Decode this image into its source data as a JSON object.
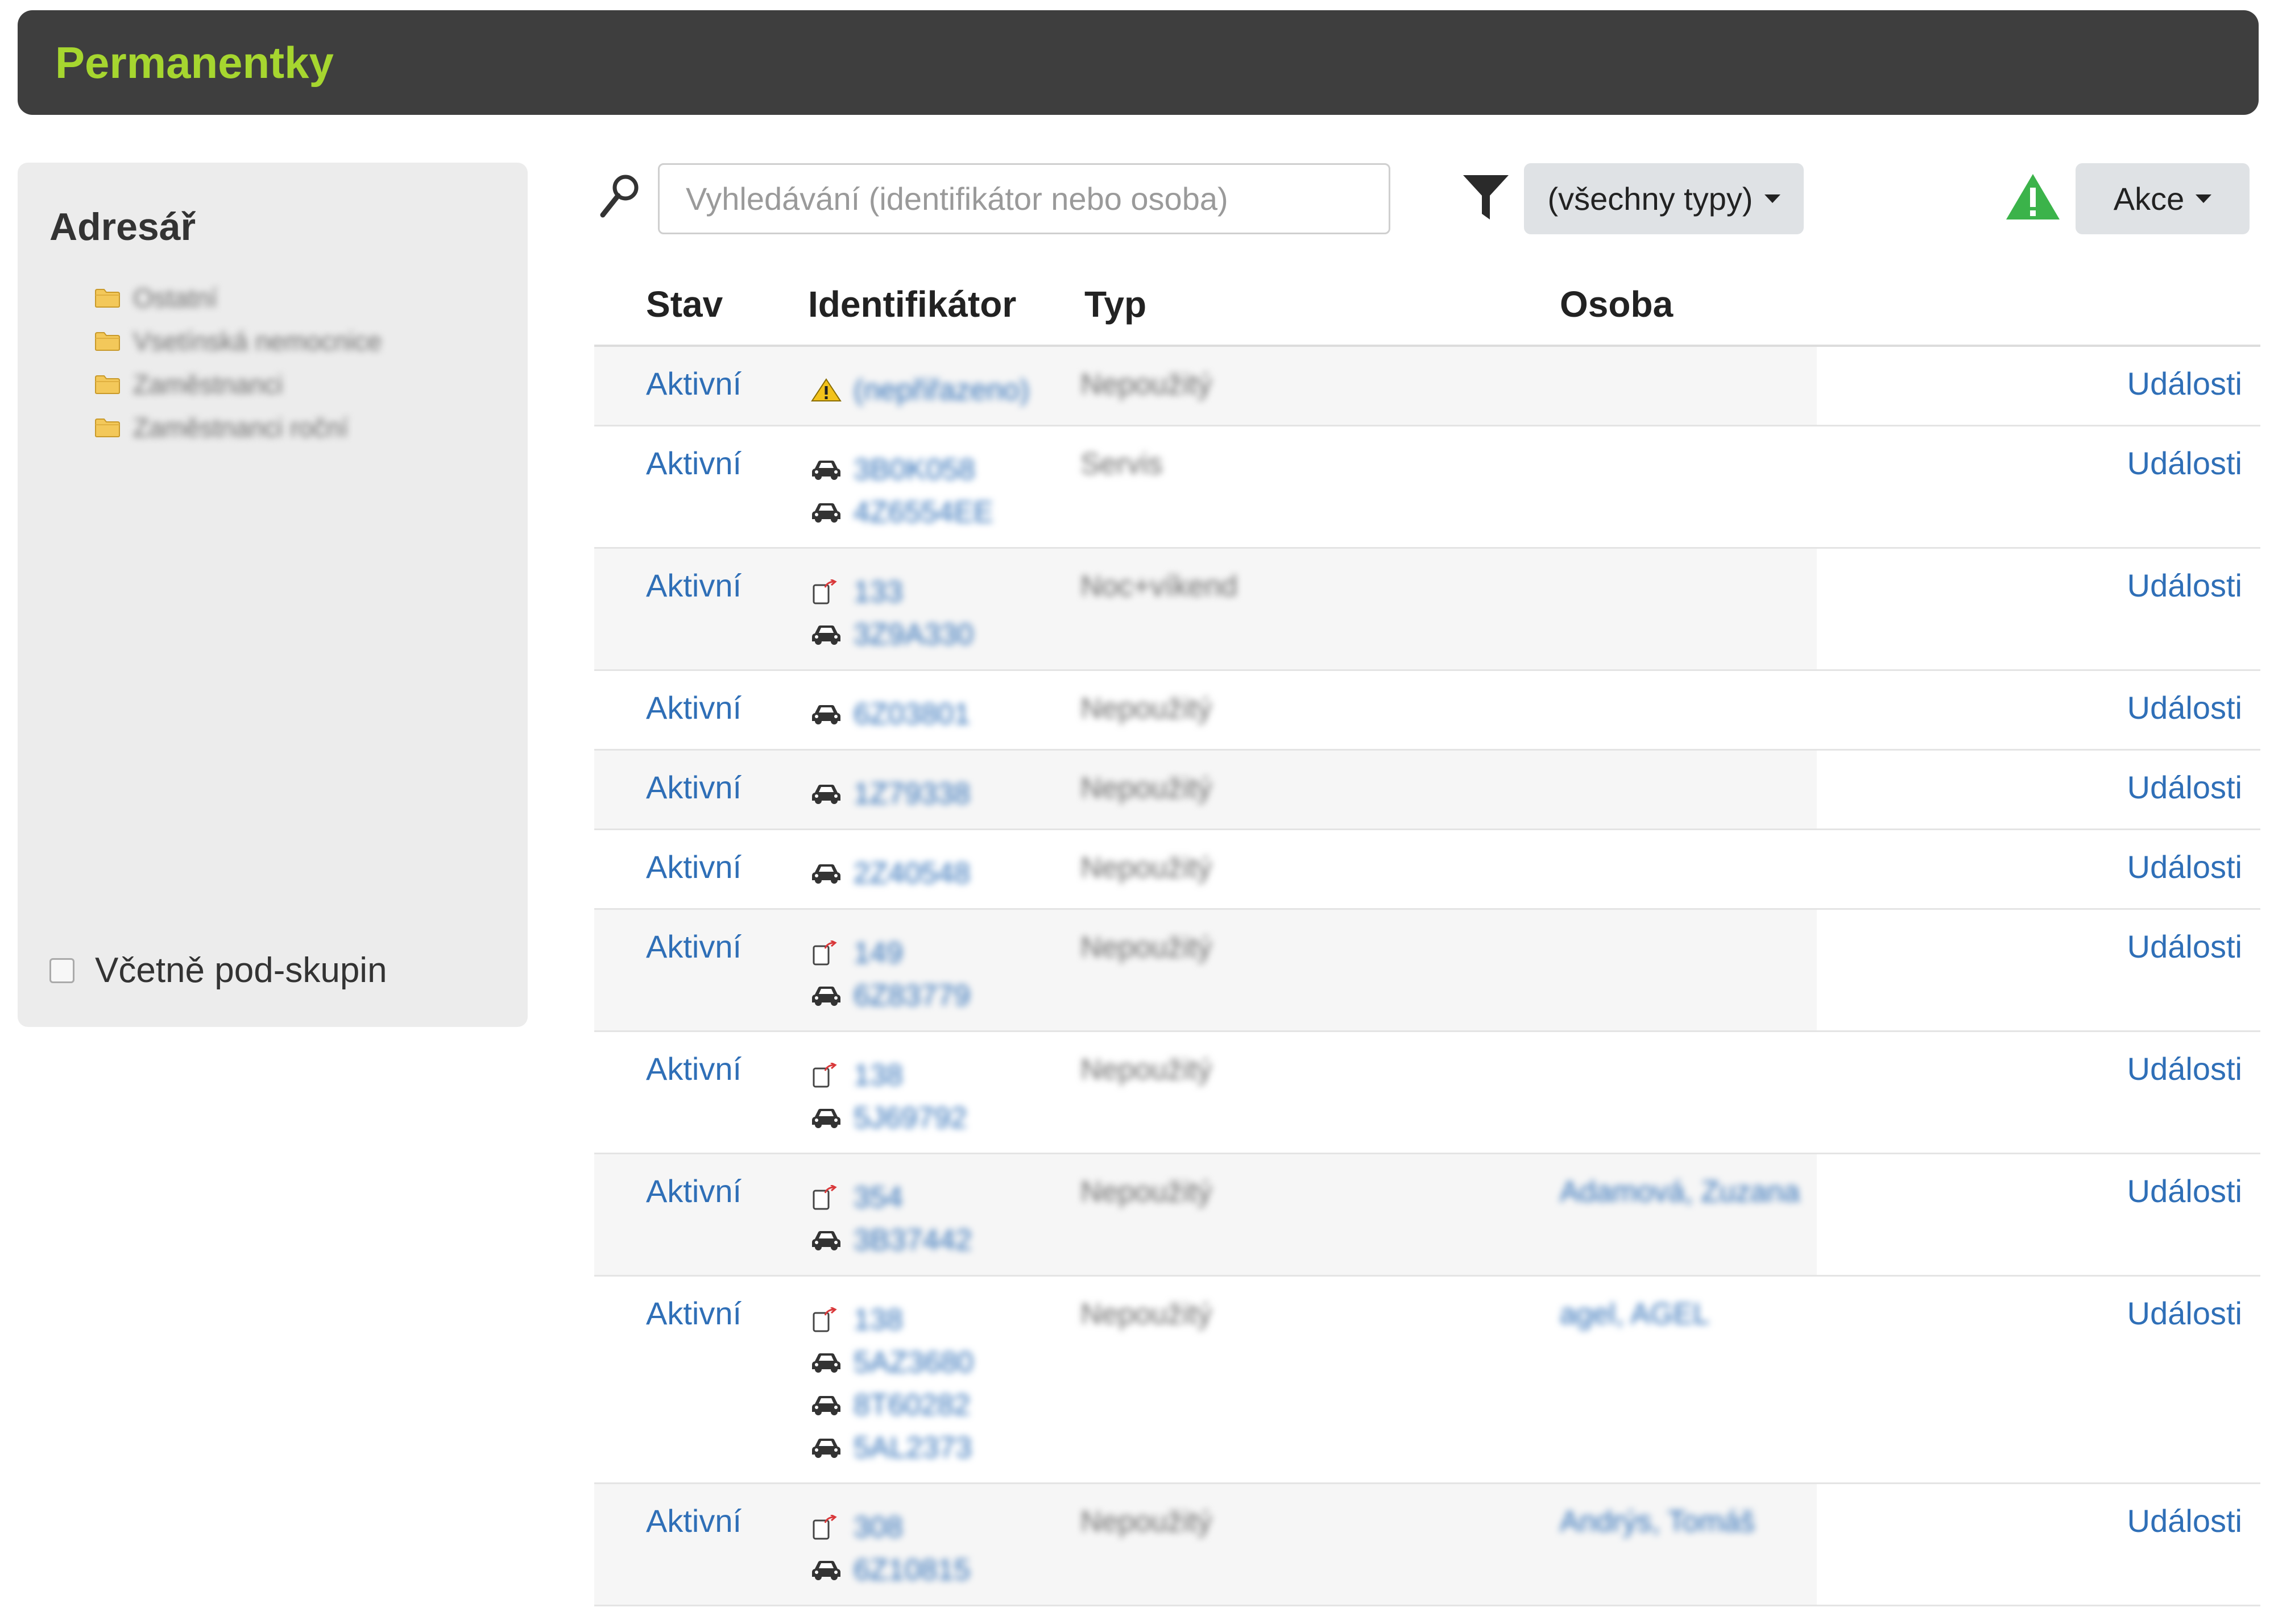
{
  "header": {
    "title": "Permanentky"
  },
  "sidebar": {
    "title": "Adresář",
    "folders": [
      {
        "label": "Ostatní"
      },
      {
        "label": "Vsetínská nemocnice"
      },
      {
        "label": "Zaměstnanci"
      },
      {
        "label": "Zaměstnanci roční"
      }
    ],
    "include_subgroups_label": "Včetně pod-skupin"
  },
  "toolbar": {
    "search_placeholder": "Vyhledávání (identifikátor nebo osoba)",
    "type_filter_label": "(všechny typy)",
    "actions_label": "Akce"
  },
  "table": {
    "headers": {
      "stav": "Stav",
      "identifikator": "Identifikátor",
      "typ": "Typ",
      "osoba": "Osoba"
    },
    "rows": [
      {
        "stav": "Aktivní",
        "identifiers": [
          {
            "icon": "warning-icon",
            "value": "(nepřiřazeno)"
          }
        ],
        "typ": "Nepoužitý",
        "osoba": "",
        "link": "Události"
      },
      {
        "stav": "Aktivní",
        "identifiers": [
          {
            "icon": "car-icon",
            "value": "3B0K058"
          },
          {
            "icon": "car-icon",
            "value": "4Z6554EE"
          }
        ],
        "typ": "Servis",
        "osoba": "",
        "link": "Události"
      },
      {
        "stav": "Aktivní",
        "identifiers": [
          {
            "icon": "card-icon",
            "value": "133"
          },
          {
            "icon": "car-icon",
            "value": "3Z9A330"
          }
        ],
        "typ": "Noc+víkend",
        "osoba": "",
        "link": "Události"
      },
      {
        "stav": "Aktivní",
        "identifiers": [
          {
            "icon": "car-icon",
            "value": "6Z03801"
          }
        ],
        "typ": "Nepoužitý",
        "osoba": "",
        "link": "Události"
      },
      {
        "stav": "Aktivní",
        "identifiers": [
          {
            "icon": "car-icon",
            "value": "1Z79338"
          }
        ],
        "typ": "Nepoužitý",
        "osoba": "",
        "link": "Události"
      },
      {
        "stav": "Aktivní",
        "identifiers": [
          {
            "icon": "car-icon",
            "value": "2Z40548"
          }
        ],
        "typ": "Nepoužitý",
        "osoba": "",
        "link": "Události"
      },
      {
        "stav": "Aktivní",
        "identifiers": [
          {
            "icon": "card-icon",
            "value": "149"
          },
          {
            "icon": "car-icon",
            "value": "6Z83779"
          }
        ],
        "typ": "Nepoužitý",
        "osoba": "",
        "link": "Události"
      },
      {
        "stav": "Aktivní",
        "identifiers": [
          {
            "icon": "card-icon",
            "value": "138"
          },
          {
            "icon": "car-icon",
            "value": "5J69792"
          }
        ],
        "typ": "Nepoužitý",
        "osoba": "",
        "link": "Události"
      },
      {
        "stav": "Aktivní",
        "identifiers": [
          {
            "icon": "card-icon",
            "value": "354"
          },
          {
            "icon": "car-icon",
            "value": "3B37442"
          }
        ],
        "typ": "Nepoužitý",
        "osoba": "Adamová, Zuzana",
        "link": "Události"
      },
      {
        "stav": "Aktivní",
        "identifiers": [
          {
            "icon": "card-icon",
            "value": "138"
          },
          {
            "icon": "car-icon",
            "value": "5AZ3680"
          },
          {
            "icon": "car-icon",
            "value": "8T60282"
          },
          {
            "icon": "car-icon",
            "value": "5AL2373"
          }
        ],
        "typ": "Nepoužitý",
        "osoba": "agel, AGEL",
        "link": "Události"
      },
      {
        "stav": "Aktivní",
        "identifiers": [
          {
            "icon": "card-icon",
            "value": "308"
          },
          {
            "icon": "car-icon",
            "value": "6Z10815"
          }
        ],
        "typ": "Nepoužitý",
        "osoba": "Andrýs, Tomáš",
        "link": "Události"
      }
    ]
  },
  "colors": {
    "header_bg": "#3e3e3e",
    "header_title": "#a6d62f",
    "link": "#2f6fb7",
    "warning_green": "#3bb34a"
  }
}
